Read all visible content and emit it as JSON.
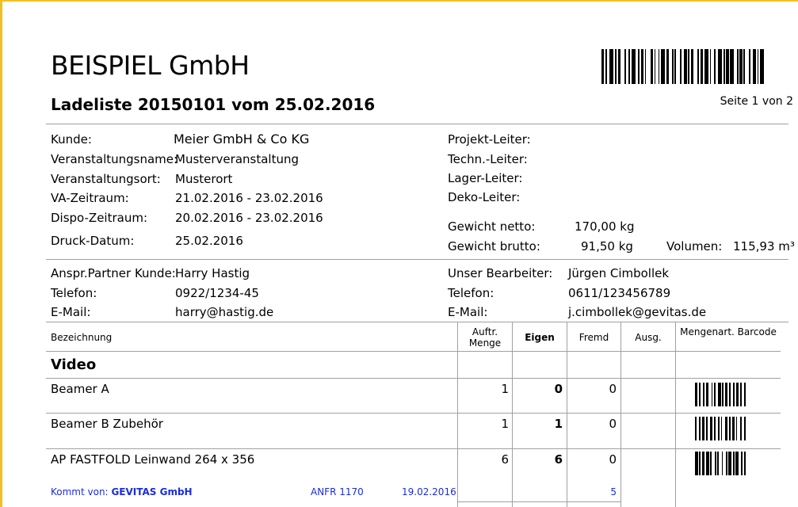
{
  "header": {
    "company": "BEISPIEL GmbH",
    "title": "Ladeliste 20150101 vom 25.02.2016",
    "page_info": "Seite 1 von 2"
  },
  "info_left": [
    {
      "label": "Kunde:",
      "value": "Meier GmbH & Co KG"
    },
    {
      "label": "Veranstaltungsname:",
      "value": "Musterveranstaltung"
    },
    {
      "label": "Veranstaltungsort:",
      "value": "Musterort"
    },
    {
      "label": "VA-Zeitraum:",
      "value": "21.02.2016 - 23.02.2016"
    },
    {
      "label": "Dispo-Zeitraum:",
      "value": "20.02.2016 - 23.02.2016"
    },
    {
      "label": "Druck-Datum:",
      "value": "25.02.2016"
    }
  ],
  "info_right": {
    "roles": [
      "Projekt-Leiter:",
      "Techn.-Leiter:",
      "Lager-Leiter:",
      "Deko-Leiter:"
    ],
    "weight_net_label": "Gewicht netto:",
    "weight_net_value": "170,00 kg",
    "weight_gross_label": "Gewicht brutto:",
    "weight_gross_value": "91,50 kg",
    "volume_label": "Volumen:",
    "volume_value": "115,93 m³"
  },
  "contacts": {
    "left": [
      {
        "label": "Anspr.Partner Kunde:",
        "value": "Harry Hastig"
      },
      {
        "label": "Telefon:",
        "value": "0922/1234-45"
      },
      {
        "label": "E-Mail:",
        "value": "harry@hastig.de"
      }
    ],
    "right": [
      {
        "label": "Unser Bearbeiter:",
        "value": "Jürgen Cimbollek"
      },
      {
        "label": "Telefon:",
        "value": "0611/123456789"
      },
      {
        "label": "E-Mail:",
        "value": "j.cimbollek@gevitas.de"
      }
    ]
  },
  "table": {
    "headers": {
      "bezeichnung": "Bezeichnung",
      "auftr_menge": "Auftr. Menge",
      "eigen": "Eigen",
      "fremd": "Fremd",
      "ausg": "Ausg.",
      "mengenart_barcode": "Mengenart. Barcode"
    },
    "group": "Video",
    "rows": [
      {
        "name": "Beamer A",
        "auftr": "1",
        "eigen": "0",
        "fremd": "0"
      },
      {
        "name": "Beamer B Zubehör",
        "auftr": "1",
        "eigen": "1",
        "fremd": "0"
      },
      {
        "name": "AP FASTFOLD Leinwand 264 x 356",
        "auftr": "6",
        "eigen": "6",
        "fremd": "0"
      }
    ],
    "source_note": {
      "prefix": "Kommt von:",
      "company": "GEVITAS GmbH",
      "ref": "ANFR 1170",
      "date": "19.02.2016",
      "qty": "5"
    }
  }
}
